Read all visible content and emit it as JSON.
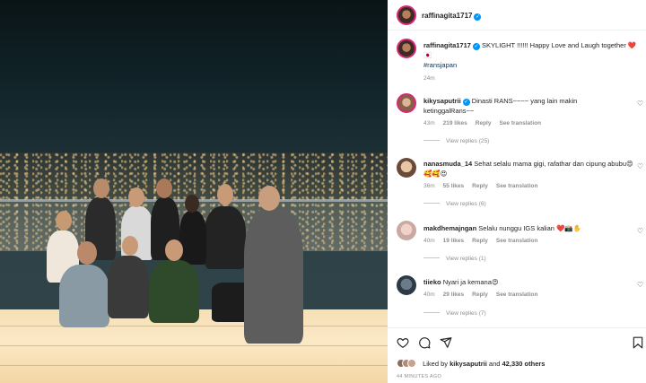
{
  "post": {
    "username": "raffinagita1717",
    "caption_text": "SKYLIGHT !!!!!! Happy Love and Laugh together ❤️🇯🇵",
    "hashtag": "#ransjapan",
    "time": "24m"
  },
  "comments": [
    {
      "username": "kikysaputrii",
      "verified": true,
      "text": "Dinasti RANS~~~~ yang lain makin ketinggalRans~~",
      "time": "43m",
      "likes": "219 likes",
      "reply_label": "Reply",
      "translate_label": "See translation",
      "view_replies": "View replies (25)"
    },
    {
      "username": "nanasmuda_14",
      "verified": false,
      "text": "Sehat selalu mama gigi, rafathar dan cipung abubu😍🥰🥰😍",
      "time": "36m",
      "likes": "55 likes",
      "reply_label": "Reply",
      "translate_label": "See translation",
      "view_replies": "View replies (6)"
    },
    {
      "username": "makdhemajngan",
      "verified": false,
      "text": "Selalu nunggu IGS kalian ❤️📸✋",
      "time": "40m",
      "likes": "19 likes",
      "reply_label": "Reply",
      "translate_label": "See translation",
      "view_replies": "View replies (1)"
    },
    {
      "username": "tiieko",
      "verified": false,
      "text": "Nyari ja kemana😍",
      "time": "40m",
      "likes": "29 likes",
      "reply_label": "Reply",
      "translate_label": "See translation",
      "view_replies": "View replies (7)"
    }
  ],
  "footer": {
    "liked_by_prefix": "Liked by",
    "liked_by_user": "kikysaputrii",
    "liked_by_and": "and",
    "liked_by_count": "42,330 others",
    "time_ago": "44 MINUTES AGO"
  },
  "icons": {
    "like": "heart-icon",
    "comment": "comment-icon",
    "share": "share-icon",
    "save": "bookmark-icon",
    "verified": "verified-badge-icon"
  },
  "colors": {
    "verified": "#0095f6",
    "hashtag": "#00376b",
    "muted": "#8e8e8e"
  }
}
